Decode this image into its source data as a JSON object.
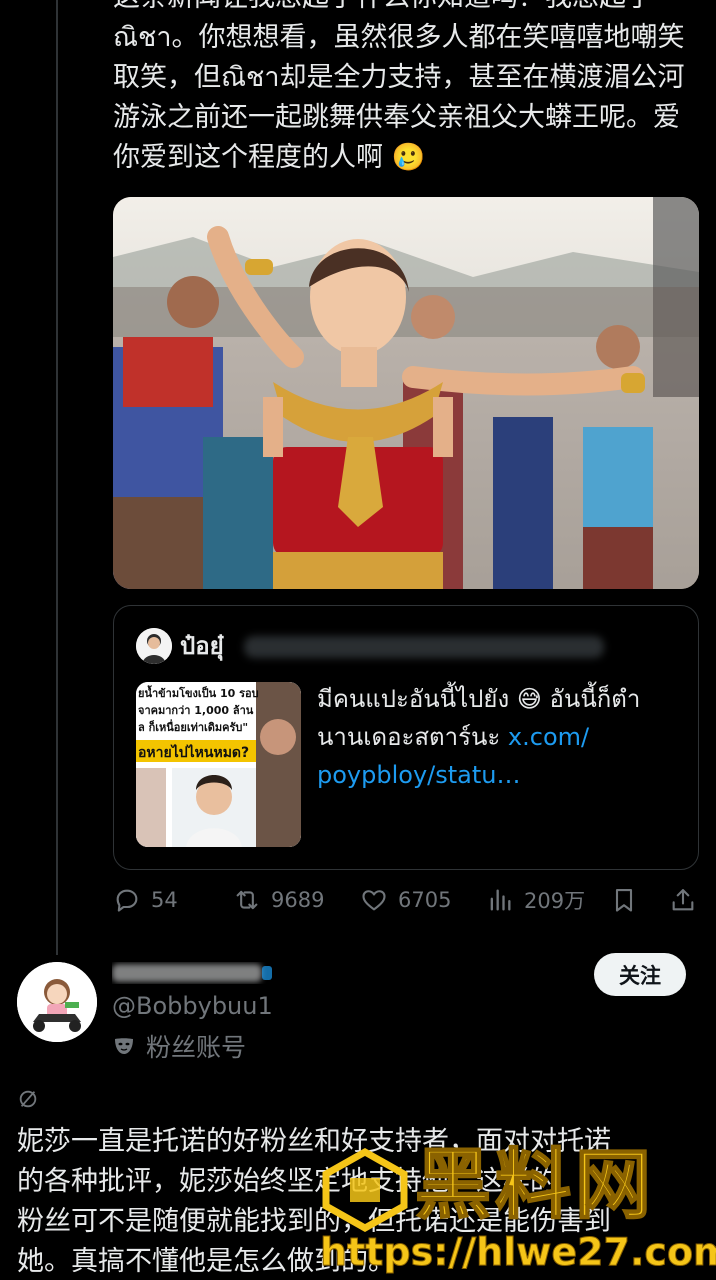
{
  "post": {
    "text_lines": [
      "这条新闻让我想起了什么你知道吗？我想起了",
      "ณิชา。你想想看，虽然很多人都在笑嘻嘻地嘲笑",
      "取笑，但ณิชา却是全力支持，甚至在横渡湄公河",
      "游泳之前还一起跳舞供奉父亲祖父大蟒王呢。爱",
      "你爱到这个程度的人啊 🥲"
    ],
    "photo_icon": "dancer-photo"
  },
  "quote": {
    "author_name": "ป๋อยุ๋",
    "text_before_emoji": "มีคนแปะอันนี้ไปยัง",
    "emoji": "😅",
    "text_after_emoji": "อันนี้ก็ตำ",
    "text_line2": "นานเดอะสตาร์นะ",
    "link_start": "x.com/",
    "link_line3": "poypbloy/statu…",
    "thumb_lines": [
      "ยน้ำข้ามโขงเป็น 10 รอบ",
      "จาคมากว่า 1,000 ล้าน",
      "ล ก็เหนื่อยเท่าเดิมครับ\"",
      "อหายไปไหนหมด?"
    ]
  },
  "actions": {
    "replies": "54",
    "reposts": "9689",
    "likes": "6705",
    "views": "209万"
  },
  "reply": {
    "handle": "@Bobbybuu1",
    "fan_label": "粉丝账号",
    "follow_label": "关注",
    "text_lines": [
      "妮莎一直是托诺的好粉丝和好支持者，面对对托诺",
      "的各种批评，妮莎始终坚定地支持他。这样的",
      "粉丝可不是随便就能找到的，但托诺还是能伤害到",
      "她。真搞不懂他是怎么做到的。"
    ]
  },
  "watermark": {
    "brand": "黑料网",
    "url": "https://hlwe27.com"
  },
  "colors": {
    "background": "#000000",
    "text": "#e7e9ea",
    "muted": "#71767b",
    "link": "#1d9bf0",
    "watermark": "#f5c518"
  }
}
